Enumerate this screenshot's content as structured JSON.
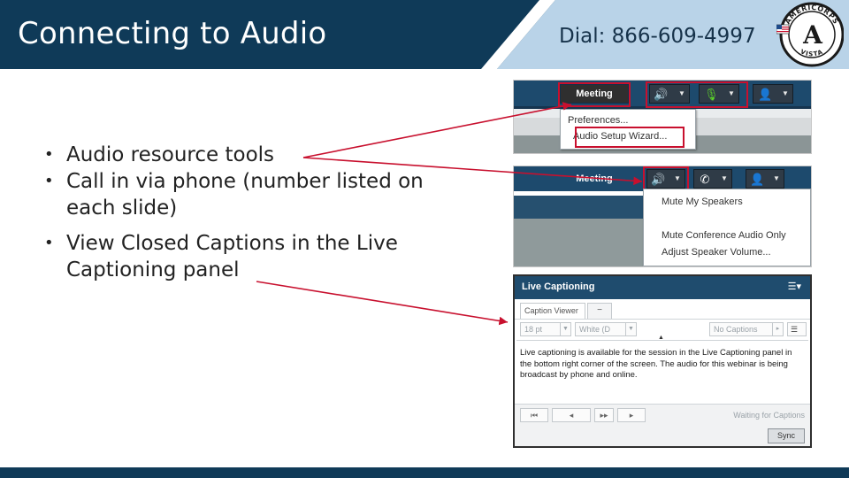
{
  "header": {
    "title": "Connecting to Audio",
    "dial": "Dial: 866-609-4997"
  },
  "logo": {
    "text_top": "AMERICORPS",
    "text_bottom": "VISTA",
    "letter": "A"
  },
  "bullets": [
    {
      "line1": "Audio resource tools",
      "line2": ""
    },
    {
      "line1": "Call in via phone (number listed on",
      "line2": "each slide)"
    },
    {
      "line1": "View Closed Captions in the Live",
      "line2": "Captioning panel"
    }
  ],
  "panel1": {
    "meeting": "Meeting",
    "menu": [
      "Preferences...",
      "Audio Setup Wizard..."
    ]
  },
  "panel2": {
    "meeting": "Meeting",
    "menu": [
      "Mute My Speakers",
      "Mute Conference Audio Only",
      "Adjust Speaker Volume..."
    ]
  },
  "panel3": {
    "title": "Live Captioning",
    "tab": "Caption Viewer",
    "tab_minus": "−",
    "font_size": "18 pt",
    "color": "White (D",
    "captions": "No Captions",
    "body": "Live captioning is available for the session in the Live Captioning panel in the bottom right corner of the screen. The audio for this webinar is being broadcast by phone and online.",
    "nav": [
      "⏮",
      "◂",
      "▸▸",
      "▸"
    ],
    "waiting": "Waiting for Captions",
    "sync": "Sync"
  },
  "colors": {
    "header_dark": "#0f3a58",
    "header_light": "#b9d3e8",
    "annotation_red": "#c8102e",
    "speaker_green": "#5bd12a"
  }
}
